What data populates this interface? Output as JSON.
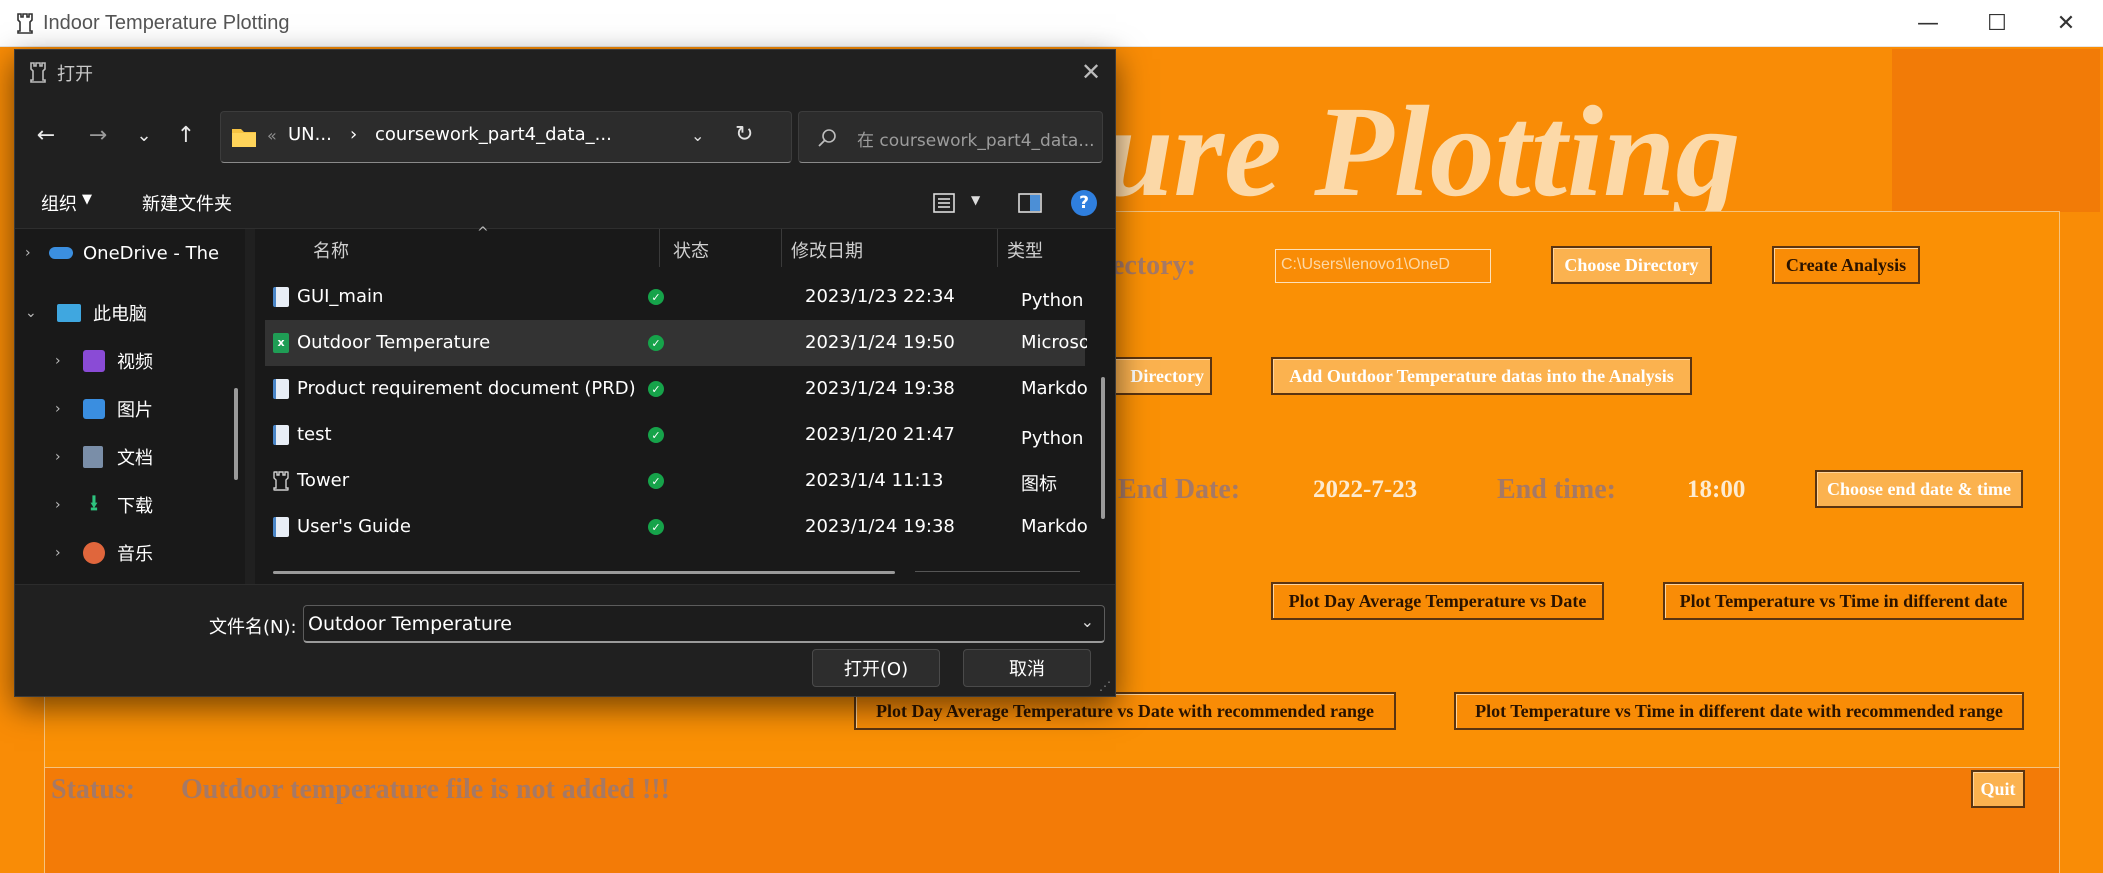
{
  "main": {
    "title": "Indoor Temperature Plotting",
    "banner": "ature Plotting",
    "labels": {
      "directory": "ectory:",
      "end_date": "End Date:",
      "end_date_value": "2022-7-23",
      "end_time": "End time:",
      "end_time_value": "18:00"
    },
    "directory_entry": "C:\\Users\\lenovo1\\OneD",
    "buttons": {
      "choose_directory": "Choose Directory",
      "create_analysis": "Create Analysis",
      "directory_partial": "Directory",
      "add_outdoor": "Add Outdoor Temperature datas into the Analysis",
      "choose_end": "Choose end date & time",
      "plot_day_avg": "Plot Day Average Temperature vs Date",
      "plot_temp_time": "Plot Temperature vs Time in different date",
      "plot_day_avg_range": "Plot Day Average Temperature vs Date with recommended range",
      "plot_temp_time_range": "Plot Temperature vs Time in different date with recommended range",
      "quit": "Quit"
    },
    "status": {
      "label": "Status:",
      "message": "Outdoor temperature file is not added !!!"
    },
    "colors": {
      "background": "#f98c06",
      "status_bg": "#f37b07",
      "banner": "#fcd9a8",
      "gray_text": "#a57966"
    }
  },
  "dialog": {
    "title": "打开",
    "nav": {
      "back": "←",
      "forward": "→",
      "recent": "⌄",
      "up": "↑",
      "refresh": "↻"
    },
    "address": {
      "prefix": "«",
      "seg1": "UN...",
      "sep": "›",
      "seg2": "coursework_part4_data_..."
    },
    "search_placeholder": "在 coursework_part4_data...",
    "toolbar": {
      "organize": "组织",
      "new_folder": "新建文件夹",
      "help": "?"
    },
    "tree": [
      {
        "label": "OneDrive - The",
        "icon": "cloud-icon"
      },
      {
        "label": "此电脑",
        "icon": "computer-icon"
      },
      {
        "label": "视频",
        "icon": "video-icon"
      },
      {
        "label": "图片",
        "icon": "picture-icon"
      },
      {
        "label": "文档",
        "icon": "document-icon"
      },
      {
        "label": "下载",
        "icon": "download-icon"
      },
      {
        "label": "音乐",
        "icon": "music-icon"
      }
    ],
    "columns": {
      "name": "名称",
      "status": "状态",
      "date": "修改日期",
      "type": "类型"
    },
    "files": [
      {
        "name": "GUI_main",
        "date": "2023/1/23 22:34",
        "type": "Python 源",
        "icon": "python-file-icon",
        "icon_color": "#4a86c8"
      },
      {
        "name": "Outdoor Temperature",
        "date": "2023/1/24 19:50",
        "type": "Microsoft",
        "icon": "excel-file-icon",
        "icon_color": "#1f9d55"
      },
      {
        "name": "Product requirement document (PRD)",
        "date": "2023/1/24 19:38",
        "type": "Markdow",
        "icon": "markdown-file-icon",
        "icon_color": "#4a86c8"
      },
      {
        "name": "test",
        "date": "2023/1/20 21:47",
        "type": "Python 源",
        "icon": "python-file-icon",
        "icon_color": "#4a86c8"
      },
      {
        "name": "Tower",
        "date": "2023/1/4 11:13",
        "type": "图标",
        "icon": "tower-icon",
        "icon_color": "#cfcfcf"
      },
      {
        "name": "User's Guide",
        "date": "2023/1/24 19:38",
        "type": "Markdow",
        "icon": "markdown-file-icon",
        "icon_color": "#4a86c8"
      }
    ],
    "status_check": "✓",
    "filename_label": "文件名(N):",
    "filename_value": "Outdoor Temperature",
    "open_button": "打开(O)",
    "cancel_button": "取消"
  }
}
